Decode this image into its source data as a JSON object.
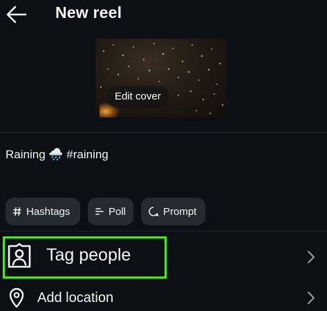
{
  "header": {
    "back_icon": "arrow-left-icon",
    "title": "New reel"
  },
  "cover": {
    "edit_label": "Edit cover"
  },
  "caption": {
    "text": "Raining 🌧️ #raining"
  },
  "chips": [
    {
      "icon": "hash-icon",
      "label": "Hashtags"
    },
    {
      "icon": "poll-icon",
      "label": "Poll"
    },
    {
      "icon": "prompt-icon",
      "label": "Prompt"
    }
  ],
  "rows": [
    {
      "icon": "person-tag-icon",
      "label": "Tag people",
      "highlighted": true,
      "chevron": "chevron-right-icon"
    },
    {
      "icon": "location-pin-icon",
      "label": "Add location",
      "chevron": "chevron-right-icon"
    }
  ],
  "colors": {
    "background": "#0c1014",
    "chip_background": "#262b31",
    "highlight_border": "#55e02a",
    "text": "#f5f5f5"
  }
}
